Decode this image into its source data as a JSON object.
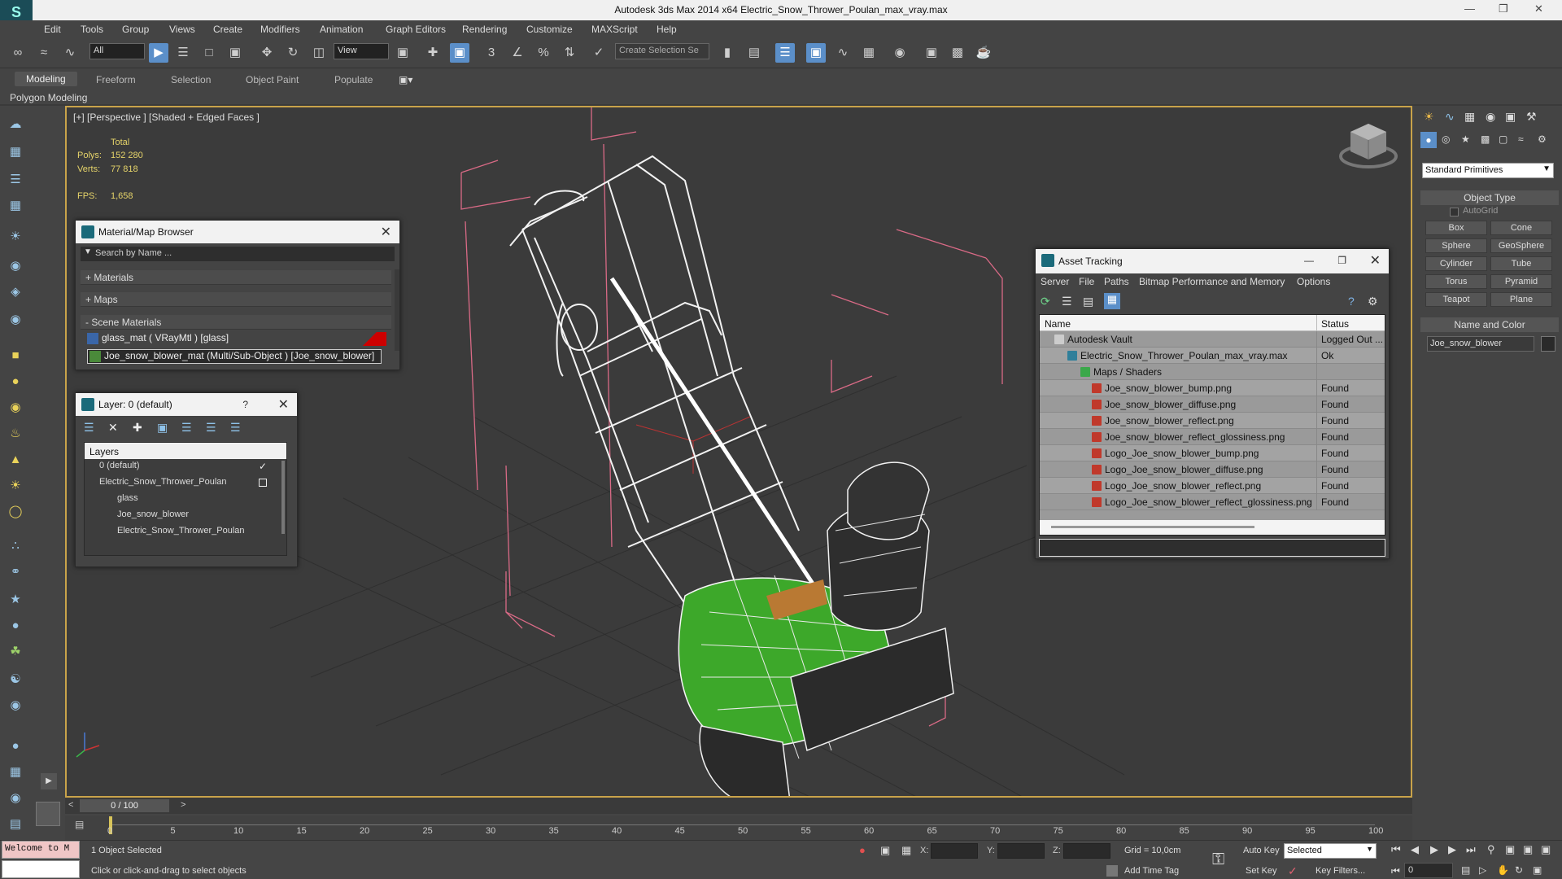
{
  "window": {
    "title": "Autodesk 3ds Max  2014 x64    Electric_Snow_Thrower_Poulan_max_vray.max"
  },
  "menu": [
    "Edit",
    "Tools",
    "Group",
    "Views",
    "Create",
    "Modifiers",
    "Animation",
    "Graph Editors",
    "Rendering",
    "Customize",
    "MAXScript",
    "Help"
  ],
  "toolbar": {
    "filter_value": "All",
    "ref_coord_value": "View",
    "selection_set_placeholder": "Create Selection Se"
  },
  "ribbon": {
    "tabs": [
      "Modeling",
      "Freeform",
      "Selection",
      "Object Paint",
      "Populate"
    ],
    "active_tab": "Modeling",
    "sub_label": "Polygon Modeling"
  },
  "viewport": {
    "label": "[+] [Perspective ] [Shaded + Edged Faces ]",
    "stats": {
      "total_label": "Total",
      "polys_label": "Polys:",
      "polys_value": "152 280",
      "verts_label": "Verts:",
      "verts_value": "77 818",
      "fps_label": "FPS:",
      "fps_value": "1,658"
    }
  },
  "material_browser": {
    "title": "Material/Map Browser",
    "search_placeholder": "Search by Name ...",
    "sections": [
      "+ Materials",
      "+ Maps",
      "- Scene Materials"
    ],
    "items": [
      "glass_mat  ( VRayMtl ) [glass]",
      "Joe_snow_blower_mat  (Multi/Sub-Object ) [Joe_snow_blower]"
    ]
  },
  "layer_panel": {
    "title": "Layer: 0 (default)",
    "help": "?",
    "header": "Layers",
    "items": [
      "0 (default)",
      "Electric_Snow_Thrower_Poulan",
      "glass",
      "Joe_snow_blower",
      "Electric_Snow_Thrower_Poulan"
    ]
  },
  "asset_tracking": {
    "title": "Asset Tracking",
    "menu": [
      "Server",
      "File",
      "Paths",
      "Bitmap Performance and Memory",
      "Options"
    ],
    "columns": [
      "Name",
      "Status"
    ],
    "rows": [
      {
        "name": "Autodesk Vault",
        "status": "Logged Out ..."
      },
      {
        "name": "Electric_Snow_Thrower_Poulan_max_vray.max",
        "status": "Ok"
      },
      {
        "name": "Maps / Shaders",
        "status": ""
      },
      {
        "name": "Joe_snow_blower_bump.png",
        "status": "Found"
      },
      {
        "name": "Joe_snow_blower_diffuse.png",
        "status": "Found"
      },
      {
        "name": "Joe_snow_blower_reflect.png",
        "status": "Found"
      },
      {
        "name": "Joe_snow_blower_reflect_glossiness.png",
        "status": "Found"
      },
      {
        "name": "Logo_Joe_snow_blower_bump.png",
        "status": "Found"
      },
      {
        "name": "Logo_Joe_snow_blower_diffuse.png",
        "status": "Found"
      },
      {
        "name": "Logo_Joe_snow_blower_reflect.png",
        "status": "Found"
      },
      {
        "name": "Logo_Joe_snow_blower_reflect_glossiness.png",
        "status": "Found"
      }
    ]
  },
  "command_panel": {
    "dropdown_value": "Standard Primitives",
    "object_type_title": "Object Type",
    "autogrid_label": "AutoGrid",
    "buttons": [
      "Box",
      "Cone",
      "Sphere",
      "GeoSphere",
      "Cylinder",
      "Tube",
      "Torus",
      "Pyramid",
      "Teapot",
      "Plane"
    ],
    "name_color_title": "Name and Color",
    "object_name": "Joe_snow_blower"
  },
  "timeline": {
    "frame_label": "0 / 100",
    "ticks": [
      "0",
      "5",
      "10",
      "15",
      "20",
      "25",
      "30",
      "35",
      "40",
      "45",
      "50",
      "55",
      "60",
      "65",
      "70",
      "75",
      "80",
      "85",
      "90",
      "95",
      "100"
    ]
  },
  "status": {
    "maxscript_text": "Welcome to M",
    "selected_text": "1 Object Selected",
    "prompt_text": "Click or click-and-drag to select objects",
    "x_label": "X:",
    "y_label": "Y:",
    "z_label": "Z:",
    "grid_text": "Grid = 10,0cm",
    "auto_key_label": "Auto Key",
    "set_key_label": "Set Key",
    "selected_dropdown": "Selected",
    "key_filters_label": "Key Filters...",
    "add_time_tag_label": "Add Time Tag",
    "frame_value": "0"
  }
}
